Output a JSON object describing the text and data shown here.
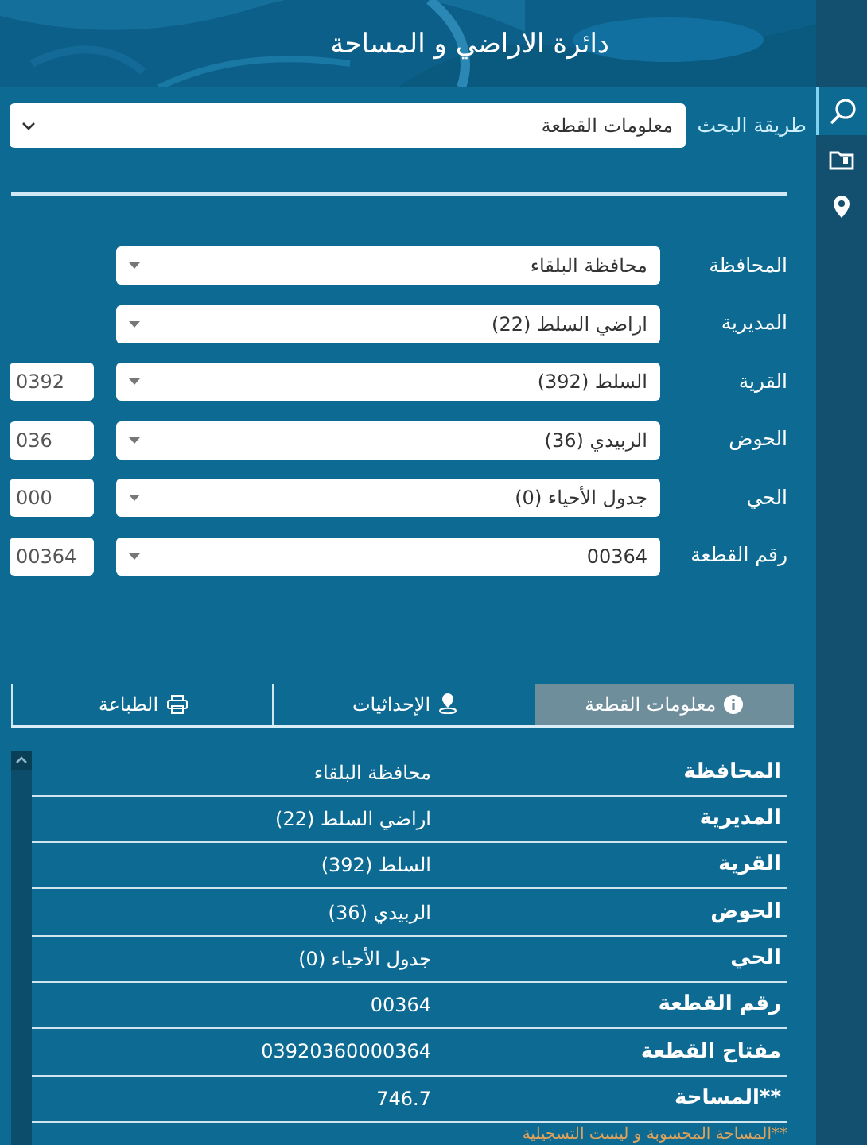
{
  "header": {
    "title": "دائرة الاراضي و المساحة"
  },
  "sidebar": {
    "items": [
      {
        "kind": "search",
        "selected": true
      },
      {
        "kind": "folder",
        "selected": false
      },
      {
        "kind": "location",
        "selected": false
      }
    ]
  },
  "search_method": {
    "label": "طريقة البحث",
    "value": "معلومات القطعة"
  },
  "form": [
    {
      "label": "المحافظة",
      "value": "محافظة البلقاء"
    },
    {
      "label": "المديرية",
      "value": "اراضي السلط (22)"
    },
    {
      "label": "القرية",
      "value": "السلط (392)",
      "code": "0392"
    },
    {
      "label": "الحوض",
      "value": "الربيدي (36)",
      "code": "036"
    },
    {
      "label": "الحي",
      "value": "جدول الأحياء (0)",
      "code": "000"
    },
    {
      "label": "رقم القطعة",
      "value": "00364",
      "code": "00364"
    }
  ],
  "tabs": [
    {
      "kind": "info",
      "label": "معلومات القطعة",
      "selected": true
    },
    {
      "kind": "coordinates",
      "label": "الإحداثيات",
      "selected": false
    },
    {
      "kind": "print",
      "label": "الطباعة",
      "selected": false
    }
  ],
  "details": [
    {
      "label": "المحافظة",
      "value": "محافظة البلقاء"
    },
    {
      "label": "المديرية",
      "value": "اراضي السلط (22)"
    },
    {
      "label": "القرية",
      "value": "السلط (392)"
    },
    {
      "label": "الحوض",
      "value": "الربيدي (36)"
    },
    {
      "label": "الحي",
      "value": "جدول الأحياء (0)"
    },
    {
      "label": "رقم القطعة",
      "value": "00364"
    },
    {
      "label": "مفتاح القطعة",
      "value": "03920360000364"
    },
    {
      "label": "**المساحة",
      "value": "746.7"
    }
  ],
  "footnote": "**المساحة المحسوبة و ليست التسجيلية"
}
